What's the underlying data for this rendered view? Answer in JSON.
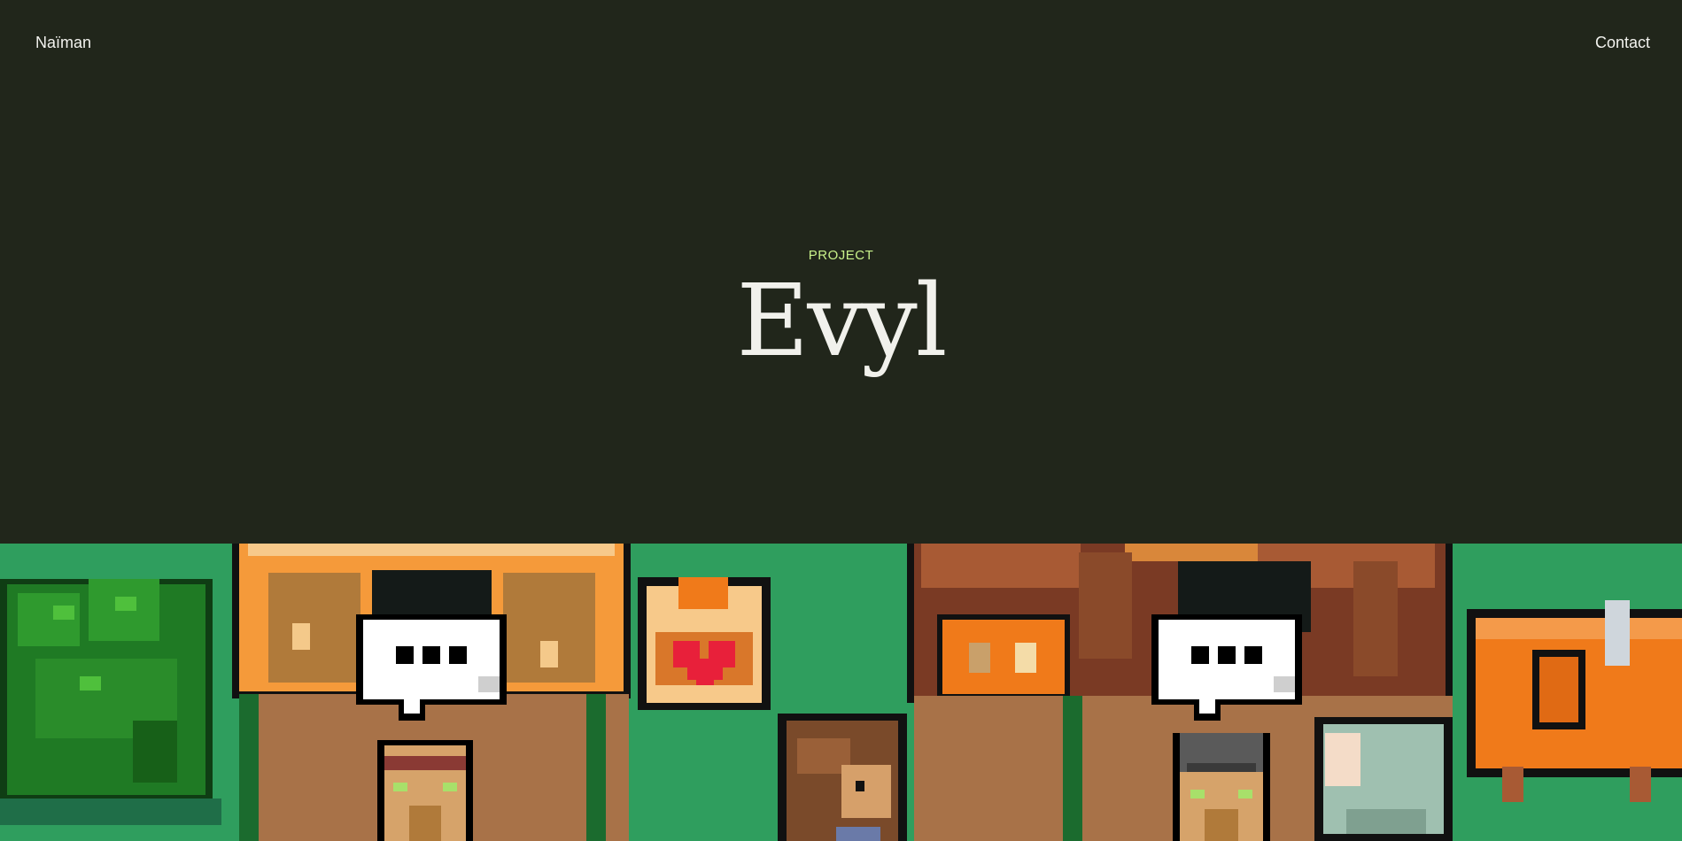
{
  "nav": {
    "brand": "Naïman",
    "contact": "Contact"
  },
  "hero": {
    "eyebrow": "PROJECT",
    "title": "Evyl"
  },
  "banner": {
    "icons": [
      "bush-icon",
      "market-stall-icon",
      "speech-bubble-icon",
      "heart-potion-icon",
      "villager-icon",
      "player-character-icon",
      "grass-tuft-icon",
      "house-icon",
      "knight-villager-icon",
      "water-jug-icon",
      "treasure-chest-icon"
    ]
  },
  "colors": {
    "background": "#21261b",
    "accent": "#c9f28a",
    "grass": "#2f9e5e",
    "text": "#f1f1ec"
  }
}
